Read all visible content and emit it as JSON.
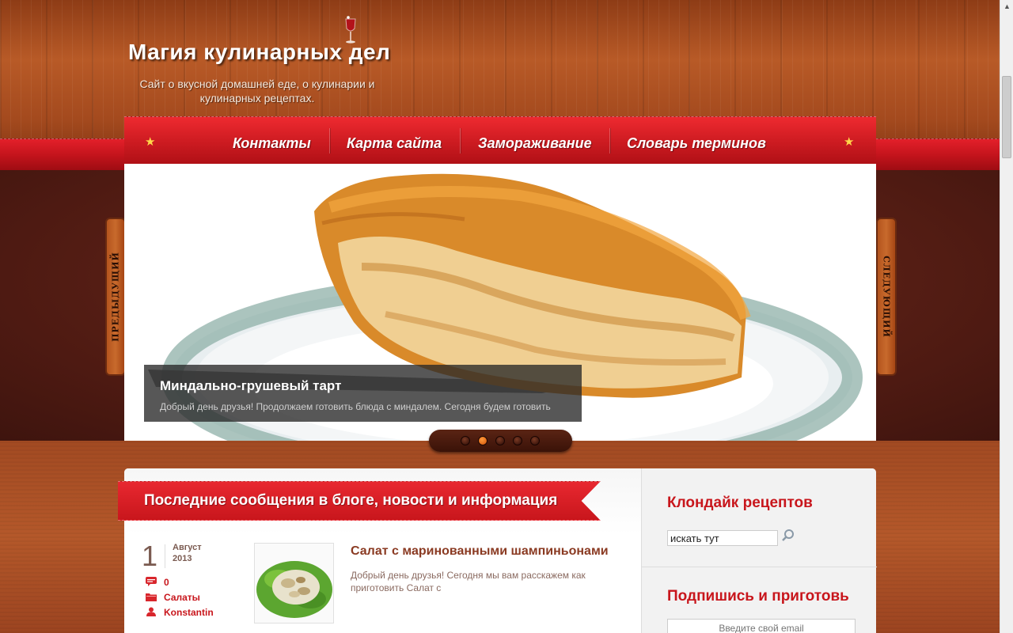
{
  "header": {
    "title": "Магия кулинарных дел",
    "tagline": "Сайт о вкусной домашней еде, о кулинарии и кулинарных рецептах."
  },
  "nav": {
    "items": [
      "Контакты",
      "Карта сайта",
      "Замораживание",
      "Словарь терминов"
    ]
  },
  "slider": {
    "prev_label": "Предыдущий",
    "next_label": "Следующий",
    "caption_title": "Миндально-грушевый тарт",
    "caption_text": "Добрый день друзья!  Продолжаем готовить блюда с миндалем. Сегодня будем готовить",
    "active_slide": 2,
    "slide_count": 5
  },
  "blog": {
    "heading": "Последние сообщения в блоге, новости и информация",
    "posts": [
      {
        "day": "1",
        "month": "Август",
        "year": "2013",
        "comments": "0",
        "category": "Салаты",
        "author": "Konstantin",
        "title": "Салат с маринованными шампиньонами",
        "excerpt": "Добрый день друзья! Сегодня мы вам расскажем как приготовить Салат с"
      }
    ]
  },
  "sidebar": {
    "recipes_title": "Клондайк рецептов",
    "search_value": "искать тут",
    "subscribe_title": "Подпишись и приготовь",
    "email_placeholder": "Введите свой email"
  },
  "colors": {
    "accent_red": "#c8161c",
    "post_title": "#8a3a22",
    "star": "#ffd84a",
    "pager_active": "#f07a1a"
  },
  "icons": [
    "wine-glass-icon",
    "star-icon",
    "comment-icon",
    "folder-icon",
    "user-icon",
    "search-icon"
  ]
}
